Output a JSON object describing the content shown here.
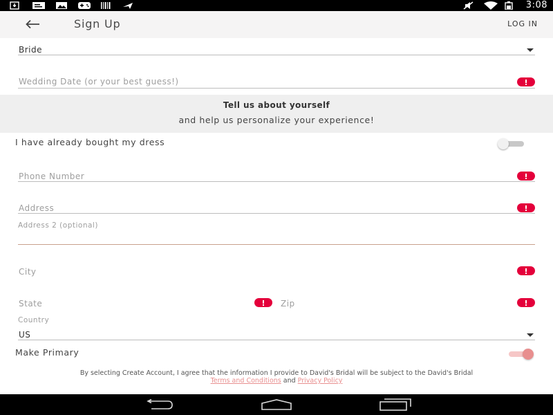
{
  "status_bar": {
    "time": "3:08",
    "left_icons": [
      "download-icon",
      "message-icon",
      "image-icon",
      "game-controller-icon",
      "barcode-icon",
      "airplane-icon"
    ],
    "right_icons": [
      "mute-icon",
      "wifi-icon",
      "battery-icon"
    ]
  },
  "app_bar": {
    "title": "Sign Up",
    "login_label": "LOG IN",
    "back_icon": "arrow-left-icon"
  },
  "form": {
    "role": {
      "value": "Bride"
    },
    "wedding_date": {
      "placeholder": "Wedding Date (or your best guess!)"
    },
    "section": {
      "title": "Tell us about yourself",
      "subtitle": "and help us personalize your experience!"
    },
    "bought_dress": {
      "label": "I have already bought my dress",
      "checked": false
    },
    "phone": {
      "placeholder": "Phone Number"
    },
    "address": {
      "placeholder": "Address"
    },
    "address2": {
      "label": "Address 2 (optional)"
    },
    "city": {
      "placeholder": "City"
    },
    "state": {
      "placeholder": "State"
    },
    "zip": {
      "placeholder": "Zip"
    },
    "country": {
      "label": "Country",
      "value": "US"
    },
    "make_primary": {
      "label": "Make Primary",
      "checked": true
    }
  },
  "terms": {
    "text": "By selecting Create Account, I agree that the information I provide to David's Bridal will be subject to the David's Bridal",
    "terms_link": "Terms and Conditions",
    "and": "and",
    "privacy_link": "Privacy Policy"
  },
  "colors": {
    "error": "#e4003b",
    "accent": "#e88f8f",
    "active_underline": "#c9a08c"
  },
  "nav_bar": {
    "back": "back-icon",
    "home": "home-icon",
    "recents": "recent-apps-icon"
  }
}
